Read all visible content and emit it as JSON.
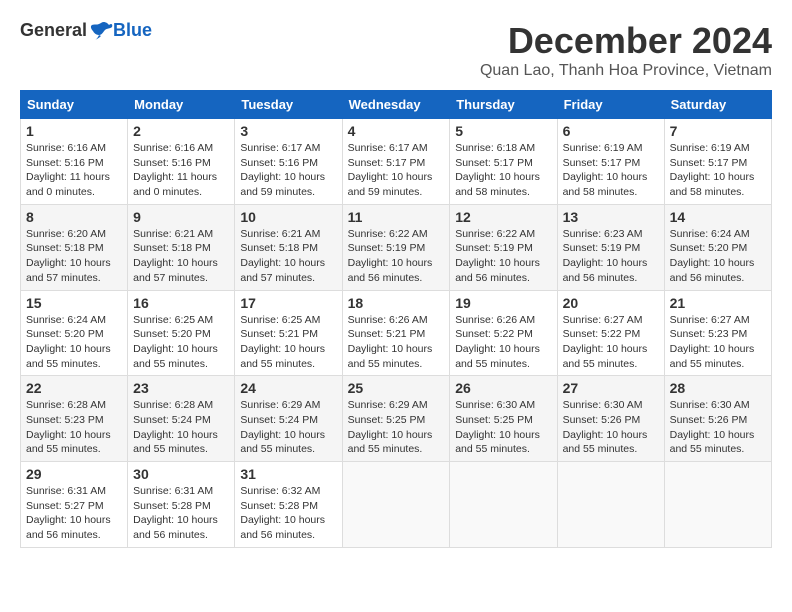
{
  "header": {
    "logo": {
      "general": "General",
      "blue": "Blue"
    },
    "title": "December 2024",
    "subtitle": "Quan Lao, Thanh Hoa Province, Vietnam"
  },
  "calendar": {
    "days_of_week": [
      "Sunday",
      "Monday",
      "Tuesday",
      "Wednesday",
      "Thursday",
      "Friday",
      "Saturday"
    ],
    "weeks": [
      [
        {
          "day": "1",
          "sunrise": "6:16 AM",
          "sunset": "5:16 PM",
          "daylight": "11 hours and 0 minutes."
        },
        {
          "day": "2",
          "sunrise": "6:16 AM",
          "sunset": "5:16 PM",
          "daylight": "11 hours and 0 minutes."
        },
        {
          "day": "3",
          "sunrise": "6:17 AM",
          "sunset": "5:16 PM",
          "daylight": "10 hours and 59 minutes."
        },
        {
          "day": "4",
          "sunrise": "6:17 AM",
          "sunset": "5:17 PM",
          "daylight": "10 hours and 59 minutes."
        },
        {
          "day": "5",
          "sunrise": "6:18 AM",
          "sunset": "5:17 PM",
          "daylight": "10 hours and 58 minutes."
        },
        {
          "day": "6",
          "sunrise": "6:19 AM",
          "sunset": "5:17 PM",
          "daylight": "10 hours and 58 minutes."
        },
        {
          "day": "7",
          "sunrise": "6:19 AM",
          "sunset": "5:17 PM",
          "daylight": "10 hours and 58 minutes."
        }
      ],
      [
        {
          "day": "8",
          "sunrise": "6:20 AM",
          "sunset": "5:18 PM",
          "daylight": "10 hours and 57 minutes."
        },
        {
          "day": "9",
          "sunrise": "6:21 AM",
          "sunset": "5:18 PM",
          "daylight": "10 hours and 57 minutes."
        },
        {
          "day": "10",
          "sunrise": "6:21 AM",
          "sunset": "5:18 PM",
          "daylight": "10 hours and 57 minutes."
        },
        {
          "day": "11",
          "sunrise": "6:22 AM",
          "sunset": "5:19 PM",
          "daylight": "10 hours and 56 minutes."
        },
        {
          "day": "12",
          "sunrise": "6:22 AM",
          "sunset": "5:19 PM",
          "daylight": "10 hours and 56 minutes."
        },
        {
          "day": "13",
          "sunrise": "6:23 AM",
          "sunset": "5:19 PM",
          "daylight": "10 hours and 56 minutes."
        },
        {
          "day": "14",
          "sunrise": "6:24 AM",
          "sunset": "5:20 PM",
          "daylight": "10 hours and 56 minutes."
        }
      ],
      [
        {
          "day": "15",
          "sunrise": "6:24 AM",
          "sunset": "5:20 PM",
          "daylight": "10 hours and 55 minutes."
        },
        {
          "day": "16",
          "sunrise": "6:25 AM",
          "sunset": "5:20 PM",
          "daylight": "10 hours and 55 minutes."
        },
        {
          "day": "17",
          "sunrise": "6:25 AM",
          "sunset": "5:21 PM",
          "daylight": "10 hours and 55 minutes."
        },
        {
          "day": "18",
          "sunrise": "6:26 AM",
          "sunset": "5:21 PM",
          "daylight": "10 hours and 55 minutes."
        },
        {
          "day": "19",
          "sunrise": "6:26 AM",
          "sunset": "5:22 PM",
          "daylight": "10 hours and 55 minutes."
        },
        {
          "day": "20",
          "sunrise": "6:27 AM",
          "sunset": "5:22 PM",
          "daylight": "10 hours and 55 minutes."
        },
        {
          "day": "21",
          "sunrise": "6:27 AM",
          "sunset": "5:23 PM",
          "daylight": "10 hours and 55 minutes."
        }
      ],
      [
        {
          "day": "22",
          "sunrise": "6:28 AM",
          "sunset": "5:23 PM",
          "daylight": "10 hours and 55 minutes."
        },
        {
          "day": "23",
          "sunrise": "6:28 AM",
          "sunset": "5:24 PM",
          "daylight": "10 hours and 55 minutes."
        },
        {
          "day": "24",
          "sunrise": "6:29 AM",
          "sunset": "5:24 PM",
          "daylight": "10 hours and 55 minutes."
        },
        {
          "day": "25",
          "sunrise": "6:29 AM",
          "sunset": "5:25 PM",
          "daylight": "10 hours and 55 minutes."
        },
        {
          "day": "26",
          "sunrise": "6:30 AM",
          "sunset": "5:25 PM",
          "daylight": "10 hours and 55 minutes."
        },
        {
          "day": "27",
          "sunrise": "6:30 AM",
          "sunset": "5:26 PM",
          "daylight": "10 hours and 55 minutes."
        },
        {
          "day": "28",
          "sunrise": "6:30 AM",
          "sunset": "5:26 PM",
          "daylight": "10 hours and 55 minutes."
        }
      ],
      [
        {
          "day": "29",
          "sunrise": "6:31 AM",
          "sunset": "5:27 PM",
          "daylight": "10 hours and 56 minutes."
        },
        {
          "day": "30",
          "sunrise": "6:31 AM",
          "sunset": "5:28 PM",
          "daylight": "10 hours and 56 minutes."
        },
        {
          "day": "31",
          "sunrise": "6:32 AM",
          "sunset": "5:28 PM",
          "daylight": "10 hours and 56 minutes."
        },
        null,
        null,
        null,
        null
      ]
    ]
  }
}
